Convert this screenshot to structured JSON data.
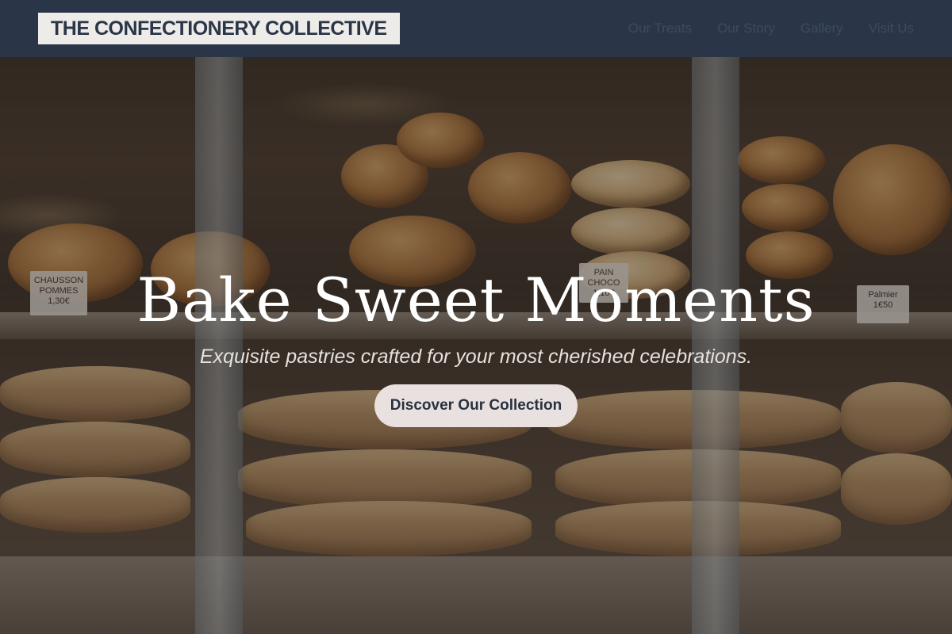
{
  "nav": {
    "brand": "THE CONFECTIONERY COLLECTIVE",
    "links": [
      "Our Treats",
      "Our Story",
      "Gallery",
      "Visit Us"
    ]
  },
  "hero": {
    "title": "Bake Sweet Moments",
    "subtitle": "Exquisite pastries crafted for your most cherished celebrations.",
    "cta_label": "Discover Our Collection",
    "background": "bakery display case with croissants, pastries and tarts",
    "price_tags": [
      {
        "label": "CHAUSSON POMMES",
        "price": "1,30€"
      },
      {
        "label": "PAIN CHOCO",
        "price": "1,10€"
      },
      {
        "label": "Palmier",
        "price": "1€50"
      }
    ]
  },
  "colors": {
    "nav_background": "#2a3648",
    "brand_background": "#eeece9",
    "brand_text": "#2a3648",
    "nav_link": "#3d4a5e",
    "cta_background": "#e9e1df",
    "cta_text": "#27313f",
    "title_text": "#ffffff"
  }
}
